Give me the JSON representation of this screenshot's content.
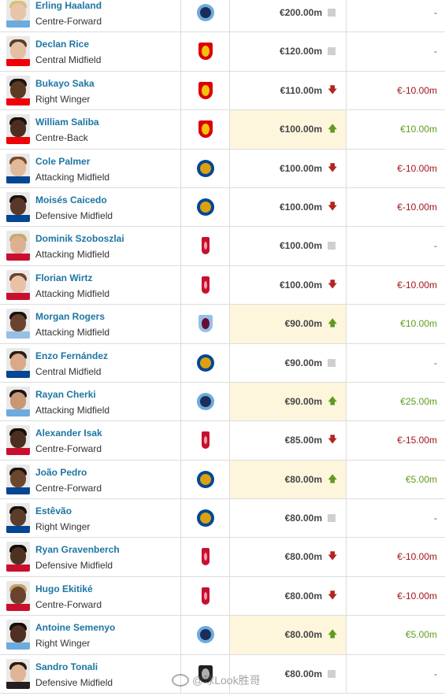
{
  "players": [
    {
      "name": "Erling Haaland",
      "position": "Centre-Forward",
      "club": "man-city",
      "value": "€200.00m",
      "trend": "none",
      "change": "-",
      "highlight": false,
      "skin": "#e8c4a8",
      "hair": "#d9c07a",
      "shirt": "#6cabdd"
    },
    {
      "name": "Declan Rice",
      "position": "Central Midfield",
      "club": "arsenal",
      "value": "€120.00m",
      "trend": "none",
      "change": "-",
      "highlight": false,
      "skin": "#e6bfa3",
      "hair": "#5a3b22",
      "shirt": "#ef0107"
    },
    {
      "name": "Bukayo Saka",
      "position": "Right Winger",
      "club": "arsenal",
      "value": "€110.00m",
      "trend": "down",
      "change": "€-10.00m",
      "highlight": false,
      "skin": "#5b3a26",
      "hair": "#1d1410",
      "shirt": "#ef0107"
    },
    {
      "name": "William Saliba",
      "position": "Centre-Back",
      "club": "arsenal",
      "value": "€100.00m",
      "trend": "up",
      "change": "€10.00m",
      "highlight": true,
      "skin": "#4a2e1f",
      "hair": "#17100c",
      "shirt": "#ef0107"
    },
    {
      "name": "Cole Palmer",
      "position": "Attacking Midfield",
      "club": "chelsea",
      "value": "€100.00m",
      "trend": "down",
      "change": "€-10.00m",
      "highlight": false,
      "skin": "#e3b99b",
      "hair": "#7a4a2a",
      "shirt": "#034694"
    },
    {
      "name": "Moisés Caicedo",
      "position": "Defensive Midfield",
      "club": "chelsea",
      "value": "€100.00m",
      "trend": "down",
      "change": "€-10.00m",
      "highlight": false,
      "skin": "#5a3827",
      "hair": "#1a120d",
      "shirt": "#034694"
    },
    {
      "name": "Dominik Szoboszlai",
      "position": "Attacking Midfield",
      "club": "liverpool",
      "value": "€100.00m",
      "trend": "none",
      "change": "-",
      "highlight": false,
      "skin": "#dcb193",
      "hair": "#c9a86a",
      "shirt": "#c8102e"
    },
    {
      "name": "Florian Wirtz",
      "position": "Attacking Midfield",
      "club": "liverpool",
      "value": "€100.00m",
      "trend": "down",
      "change": "€-10.00m",
      "highlight": false,
      "skin": "#e9c2a6",
      "hair": "#6b4328",
      "shirt": "#c8102e"
    },
    {
      "name": "Morgan Rogers",
      "position": "Attacking Midfield",
      "club": "aston-villa",
      "value": "€90.00m",
      "trend": "up",
      "change": "€10.00m",
      "highlight": true,
      "skin": "#6a4330",
      "hair": "#1c1410",
      "shirt": "#95bfe5"
    },
    {
      "name": "Enzo Fernández",
      "position": "Central Midfield",
      "club": "chelsea",
      "value": "€90.00m",
      "trend": "none",
      "change": "-",
      "highlight": false,
      "skin": "#d9a98a",
      "hair": "#2b1c12",
      "shirt": "#034694"
    },
    {
      "name": "Rayan Cherki",
      "position": "Attacking Midfield",
      "club": "man-city",
      "value": "€90.00m",
      "trend": "up",
      "change": "€25.00m",
      "highlight": true,
      "skin": "#c99676",
      "hair": "#1d1410",
      "shirt": "#6cabdd"
    },
    {
      "name": "Alexander Isak",
      "position": "Centre-Forward",
      "club": "liverpool",
      "value": "€85.00m",
      "trend": "down",
      "change": "€-15.00m",
      "highlight": false,
      "skin": "#4c2f20",
      "hair": "#140e0a",
      "shirt": "#c8102e"
    },
    {
      "name": "João Pedro",
      "position": "Centre-Forward",
      "club": "chelsea",
      "value": "€80.00m",
      "trend": "up",
      "change": "€5.00m",
      "highlight": true,
      "skin": "#6d4630",
      "hair": "#1b130e",
      "shirt": "#034694"
    },
    {
      "name": "Estêvão",
      "position": "Right Winger",
      "club": "chelsea",
      "value": "€80.00m",
      "trend": "none",
      "change": "-",
      "highlight": false,
      "skin": "#5d3c2a",
      "hair": "#150f0b",
      "shirt": "#034694"
    },
    {
      "name": "Ryan Gravenberch",
      "position": "Defensive Midfield",
      "club": "liverpool",
      "value": "€80.00m",
      "trend": "down",
      "change": "€-10.00m",
      "highlight": false,
      "skin": "#4f3122",
      "hair": "#120c09",
      "shirt": "#c8102e"
    },
    {
      "name": "Hugo Ekitiké",
      "position": "Centre-Forward",
      "club": "liverpool",
      "value": "€80.00m",
      "trend": "down",
      "change": "€-10.00m",
      "highlight": false,
      "skin": "#6a432e",
      "hair": "#c4a46a",
      "shirt": "#c8102e"
    },
    {
      "name": "Antoine Semenyo",
      "position": "Right Winger",
      "club": "man-city",
      "value": "€80.00m",
      "trend": "up",
      "change": "€5.00m",
      "highlight": true,
      "skin": "#4e3123",
      "hair": "#130d0a",
      "shirt": "#6cabdd"
    },
    {
      "name": "Sandro Tonali",
      "position": "Defensive Midfield",
      "club": "newcastle",
      "value": "€80.00m",
      "trend": "none",
      "change": "-",
      "highlight": false,
      "skin": "#e0b596",
      "hair": "#2a1a10",
      "shirt": "#241f20"
    }
  ],
  "clubs": {
    "man-city": {
      "outer": "#6cabdd",
      "inner": "#1c2c5b"
    },
    "arsenal": {
      "outer": "#db0007",
      "inner": "#f4c20d"
    },
    "chelsea": {
      "outer": "#034694",
      "inner": "#dba111"
    },
    "liverpool": {
      "outer": "#c8102e",
      "inner": "#f2a1ad"
    },
    "aston-villa": {
      "outer": "#95bfe5",
      "inner": "#670e36"
    },
    "newcastle": {
      "outer": "#241f20",
      "inner": "#b0b0b0"
    }
  },
  "watermark": "@球Look胜哥",
  "icons": {
    "trend_up": "arrow-up-icon",
    "trend_down": "arrow-down-icon",
    "trend_none": "no-change-icon"
  }
}
